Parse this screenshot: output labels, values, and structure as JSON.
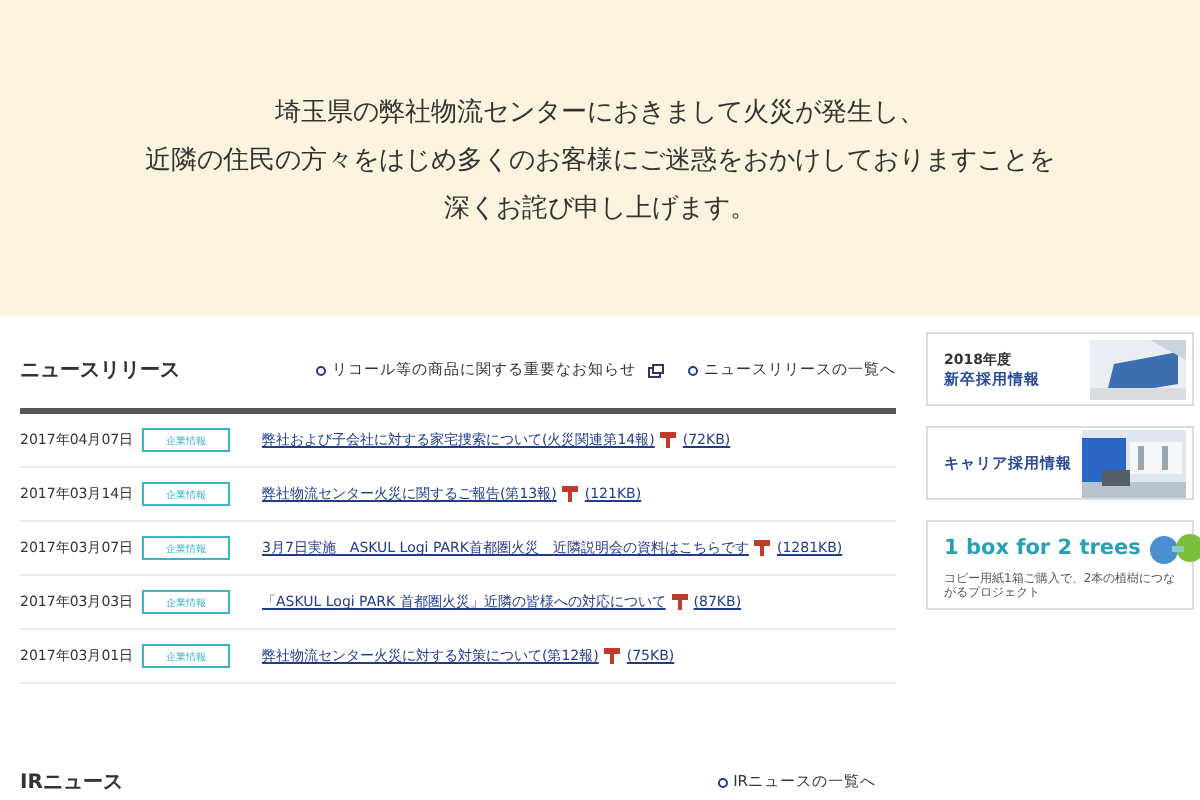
{
  "notice": {
    "lines": [
      "埼玉県の弊社物流センターにおきまして火災が発生し、",
      "近隣の住民の方々をはじめ多くのお客様にご迷惑をおかけしておりますことを",
      "深くお詫び申し上げます。"
    ]
  },
  "news": {
    "title": "ニュースリリース",
    "links": [
      {
        "label": "リコール等の商品に関する重要なお知らせ",
        "external": true
      },
      {
        "label": "ニュースリリースの一覧へ",
        "external": false
      }
    ],
    "items": [
      {
        "date": "2017年04月07日",
        "tag": "企業情報",
        "title": "弊社および子会社に対する家宅捜索について(火災関連第14報)",
        "size": "(72KB)"
      },
      {
        "date": "2017年03月14日",
        "tag": "企業情報",
        "title": "弊社物流センター火災に関するご報告(第13報)",
        "size": "(121KB)"
      },
      {
        "date": "2017年03月07日",
        "tag": "企業情報",
        "title": "3月7日実施　ASKUL Logi PARK首都圏火災　近隣説明会の資料はこちらです",
        "size": "(1281KB)"
      },
      {
        "date": "2017年03月03日",
        "tag": "企業情報",
        "title": "「ASKUL Logi PARK 首都圏火災」近隣の皆様への対応について",
        "size": "(87KB)"
      },
      {
        "date": "2017年03月01日",
        "tag": "企業情報",
        "title": "弊社物流センター火災に対する対策について(第12報)",
        "size": "(75KB)"
      }
    ]
  },
  "banners": [
    {
      "kind": "recruit",
      "line1": "2018年度",
      "line2": "新卒採用情報"
    },
    {
      "kind": "career",
      "line1": "キャリア採用情報"
    },
    {
      "kind": "trees",
      "line1": "1 box for 2 trees",
      "line2": "コピー用紙1箱ご購入で、2本の植樹につながるプロジェクト"
    }
  ],
  "ir": {
    "title": "IRニュース",
    "link": "IRニュースの一覧へ"
  }
}
